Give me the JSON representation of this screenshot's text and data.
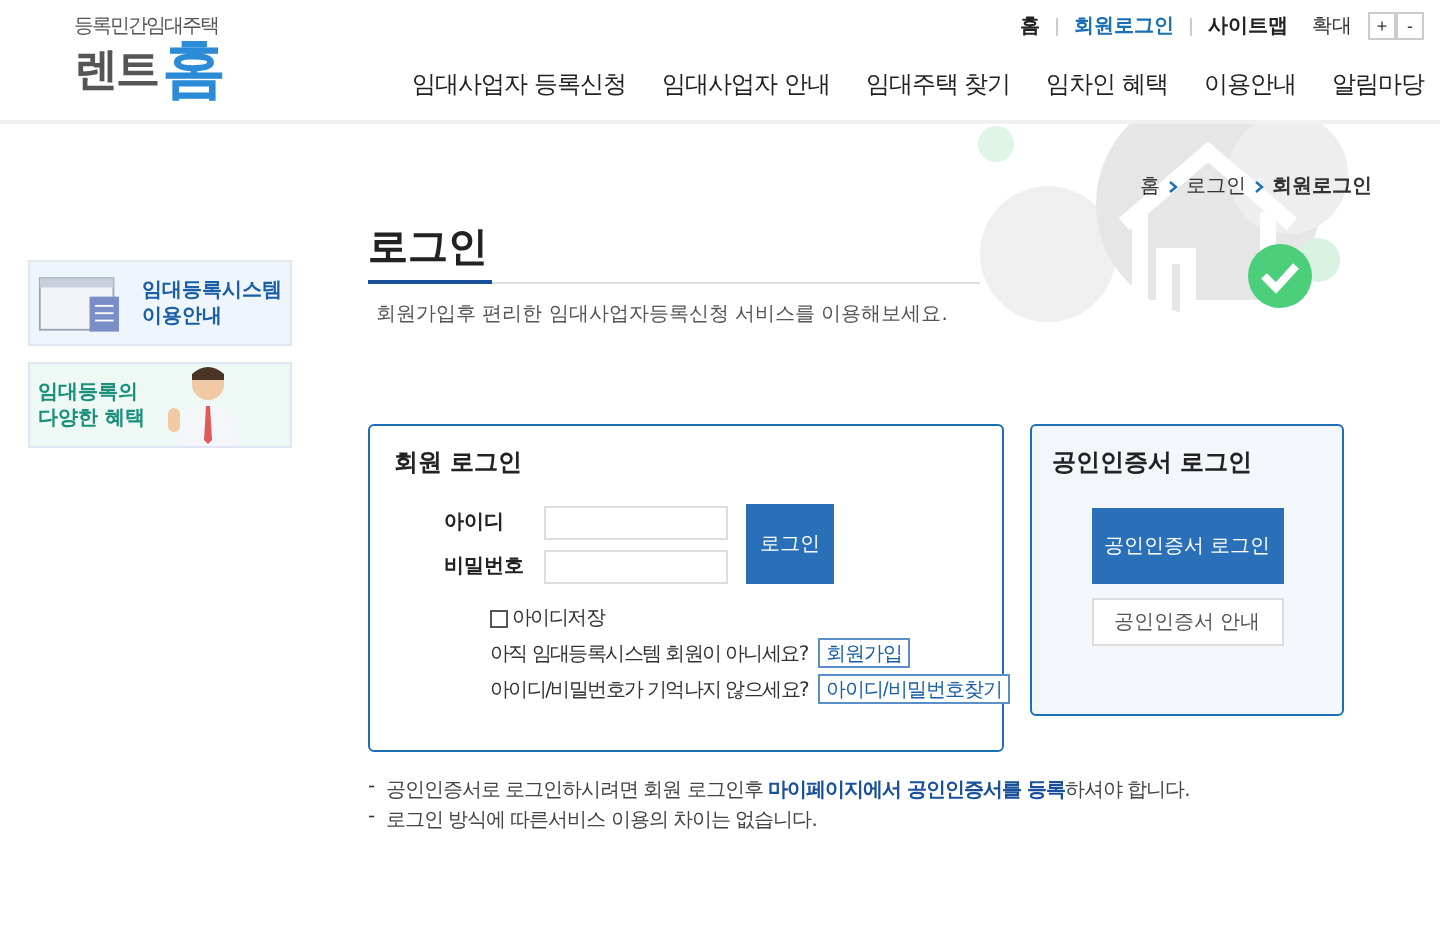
{
  "logo": {
    "tagline": "등록민간임대주택",
    "word": "렌트",
    "home": "홈"
  },
  "top_links": [
    {
      "label": "홈",
      "active": false
    },
    {
      "label": "회원로그인",
      "active": true
    },
    {
      "label": "사이트맵",
      "active": false
    }
  ],
  "zoom": {
    "label": "확대",
    "buttons": [
      "+",
      "-"
    ]
  },
  "nav": [
    "임대사업자 등록신청",
    "임대사업자 안내",
    "임대주택 찾기",
    "임차인 혜택",
    "이용안내",
    "알림마당"
  ],
  "breadcrumb": [
    "홈",
    "로그인",
    "회원로그인"
  ],
  "title": "로그인",
  "subtitle": "회원가입후 편리한 임대사업자등록신청 서비스를 이용해보세요.",
  "side_banners": [
    {
      "kind": "guide",
      "lines": [
        "임대등록시스템",
        "이용안내"
      ]
    },
    {
      "kind": "benefit",
      "lines": [
        "임대등록의",
        "다양한 혜택"
      ]
    }
  ],
  "member_login": {
    "title": "회원 로그인",
    "id_label": "아이디",
    "pw_label": "비밀번호",
    "submit": "로그인",
    "remember": {
      "label": "아이디저장",
      "checked": false
    },
    "links": [
      {
        "question": "아직 임대등록시스템 회원이 아니세요?",
        "button": "회원가입"
      },
      {
        "question": "아이디/비밀번호가 기억나지 않으세요?",
        "button": "아이디/비밀번호찾기"
      }
    ]
  },
  "cert_login": {
    "title": "공인인증서 로그인",
    "button": "공인인증서 로그인",
    "guide": "공인인증서 안내"
  },
  "notes": [
    {
      "marker": "-",
      "text": "공인인증서로 로그인하시려면 회원 로그인후 **마이페이지에서 공인인증서를 등록**하셔야 합니다."
    },
    {
      "marker": "-",
      "text": "로그인 방식에 따른서비스 이용의 차이는 없습니다."
    }
  ]
}
